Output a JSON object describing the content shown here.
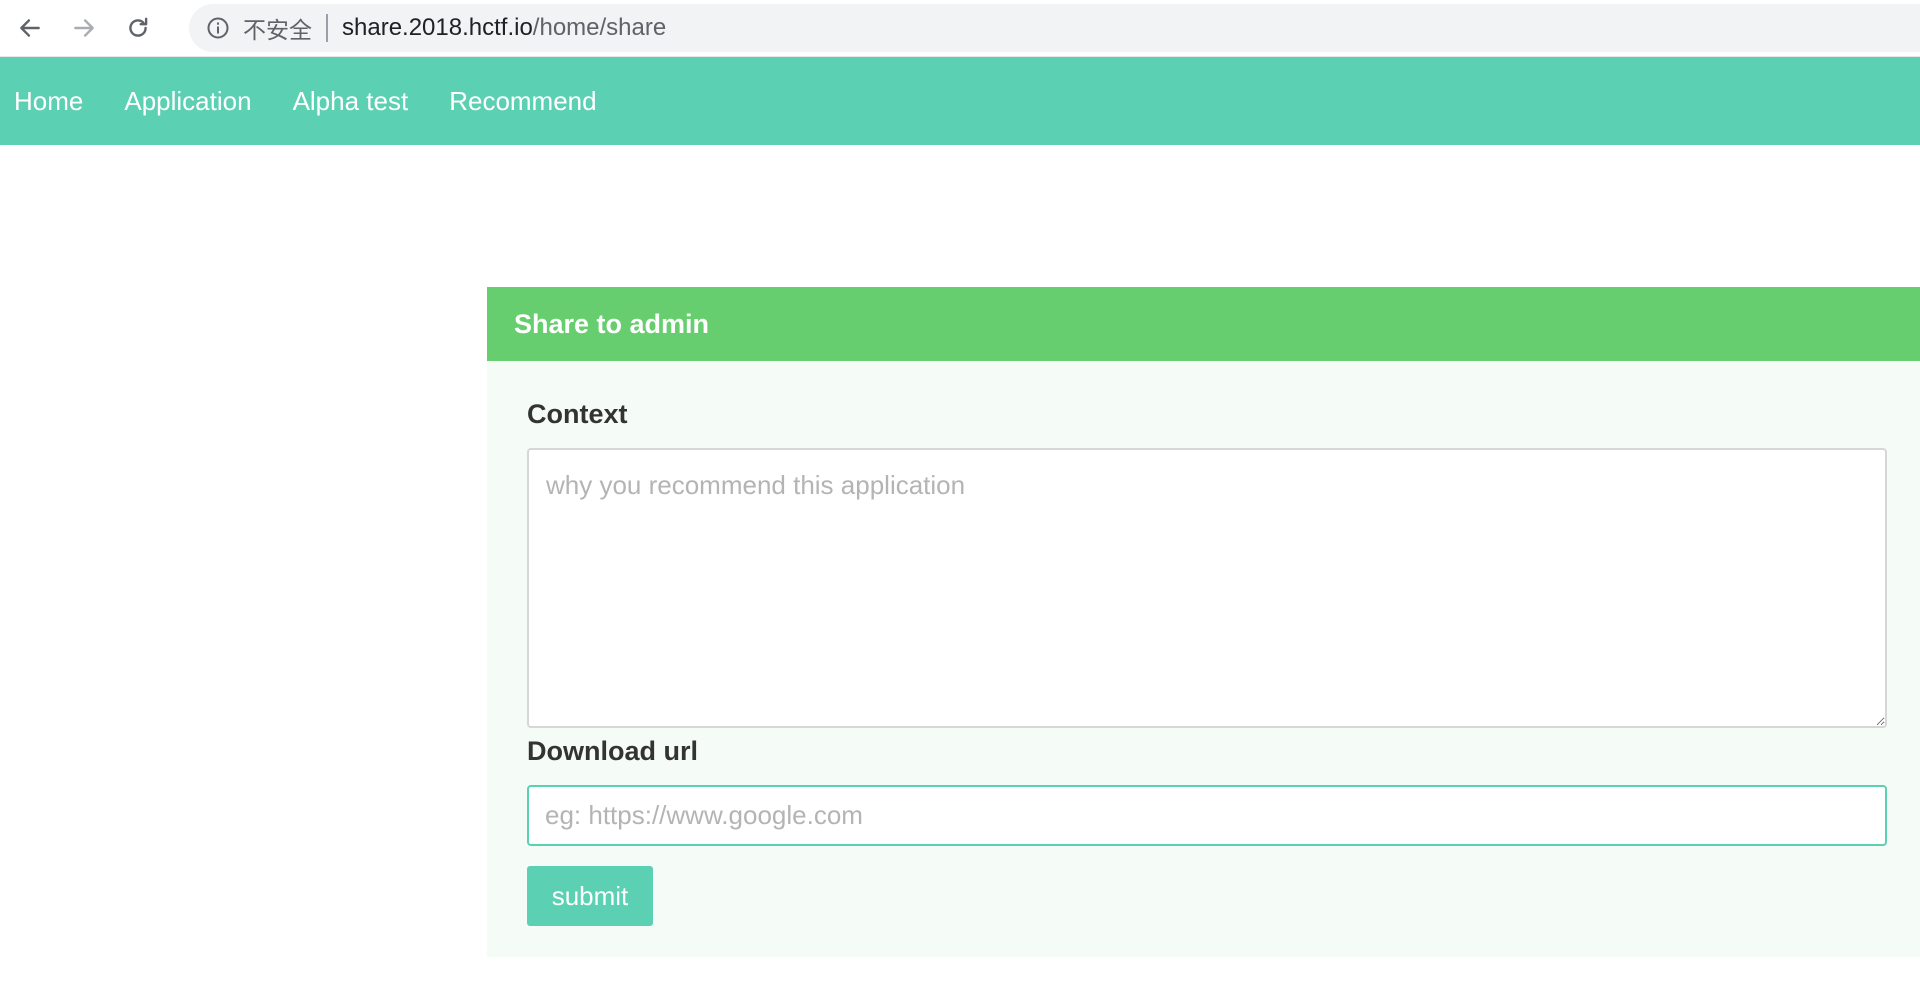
{
  "browser": {
    "security_label": "不安全",
    "url_host": "share.2018.hctf.io",
    "url_path": "/home/share",
    "icons": {
      "back": "arrow-left-icon",
      "forward": "arrow-right-icon",
      "reload": "reload-icon",
      "info": "info-icon"
    }
  },
  "nav": {
    "items": [
      {
        "label": "Home"
      },
      {
        "label": "Application"
      },
      {
        "label": "Alpha test"
      },
      {
        "label": "Recommend"
      }
    ]
  },
  "panel": {
    "title": "Share to admin",
    "context": {
      "label": "Context",
      "placeholder": "why you recommend this application",
      "value": ""
    },
    "download": {
      "label": "Download url",
      "placeholder": "eg: https://www.google.com",
      "value": ""
    },
    "submit_label": "submit"
  },
  "colors": {
    "nav_bg": "#5cd0b3",
    "panel_header_bg": "#66ce6e",
    "panel_body_bg": "#f5fbf7",
    "button_bg": "#5cd0b3",
    "input_focus_border": "#5cd0b3"
  }
}
